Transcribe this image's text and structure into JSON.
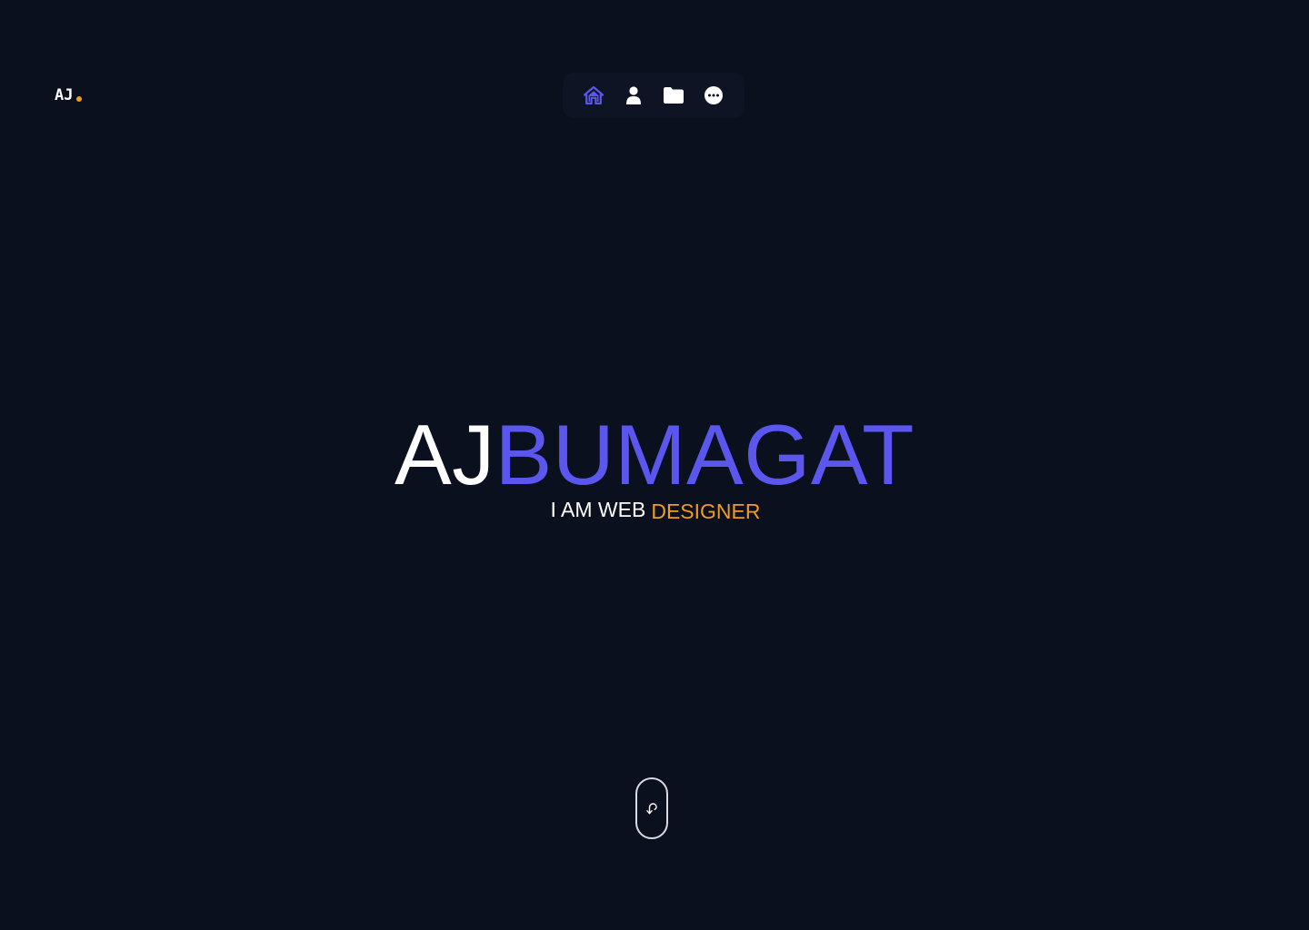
{
  "logo": {
    "text": "AJ",
    "dot_color": "#f29b1d"
  },
  "nav": {
    "items": [
      {
        "icon": "home-icon",
        "active": true,
        "color": "#5b57ee"
      },
      {
        "icon": "user-icon",
        "active": false,
        "color": "#ffffff"
      },
      {
        "icon": "folder-icon",
        "active": false,
        "color": "#ffffff"
      },
      {
        "icon": "more-icon",
        "active": false,
        "color": "#ffffff"
      }
    ]
  },
  "hero": {
    "first_name": "AJ",
    "last_name": "BUMAGAT",
    "tagline_prefix": "I AM WEB",
    "tagline_role": "DESIGNER"
  },
  "scroll": {
    "icon": "scroll-down-arrow-icon"
  },
  "colors": {
    "background": "#0b101e",
    "accent": "#5b57ee",
    "highlight": "#f29b1d",
    "text": "#ffffff"
  }
}
